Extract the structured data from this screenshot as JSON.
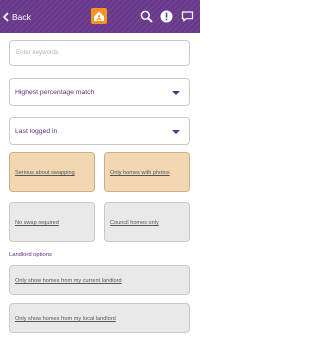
{
  "header": {
    "back_label": "Back",
    "logo": "house-logo-icon",
    "icons": [
      "search-icon",
      "alert-icon",
      "chat-icon"
    ],
    "background_color": "#6a3a8e"
  },
  "search": {
    "placeholder": "Enter keywords"
  },
  "sort_select": {
    "value": "Highest percentage match"
  },
  "activity_select": {
    "value": "Last logged in"
  },
  "filters": [
    {
      "label": "Serious about swapping",
      "selected": true
    },
    {
      "label": "Only homes with photos",
      "selected": true
    },
    {
      "label": "No swap required",
      "selected": false
    },
    {
      "label": "Council homes only",
      "selected": false
    }
  ],
  "landlord": {
    "heading": "Landlord options",
    "options": [
      {
        "label": "Only show homes from my current landlord",
        "selected": false
      },
      {
        "label": "Only show homes from my local landlord",
        "selected": false
      }
    ]
  },
  "colors": {
    "accent": "#5a2d82",
    "selected_fill": "#f1d8b2",
    "unselected_fill": "#e9e9e9",
    "logo_orange": "#f7941d"
  }
}
